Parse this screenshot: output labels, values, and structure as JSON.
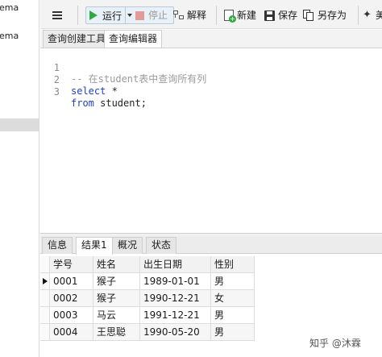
{
  "navigator": {
    "items": [
      "hema",
      "hema"
    ]
  },
  "toolbar": {
    "run_label": "运行",
    "stop_label": "停止",
    "explain_label": "解释",
    "new_label": "新建",
    "save_label": "保存",
    "saveas_label": "另存为",
    "beautify_label": "美"
  },
  "tabs": [
    {
      "label": "查询创建工具"
    },
    {
      "label": "查询编辑器"
    }
  ],
  "editor": {
    "lines": [
      {
        "num": "1",
        "parts": [
          {
            "type": "comment",
            "text": "-- 在student表中查询所有列"
          }
        ]
      },
      {
        "num": "2",
        "parts": [
          {
            "type": "kw",
            "text": "select"
          },
          {
            "type": "plain",
            "text": " *"
          }
        ]
      },
      {
        "num": "3",
        "parts": [
          {
            "type": "kw",
            "text": "from"
          },
          {
            "type": "plain",
            "text": " student;"
          }
        ]
      }
    ]
  },
  "result_tabs": [
    {
      "label": "信息"
    },
    {
      "label": "结果1"
    },
    {
      "label": "概况"
    },
    {
      "label": "状态"
    }
  ],
  "grid": {
    "columns": [
      "学号",
      "姓名",
      "出生日期",
      "性别"
    ],
    "rows": [
      [
        "0001",
        "猴子",
        "1989-01-01",
        "男"
      ],
      [
        "0002",
        "猴子",
        "1990-12-21",
        "女"
      ],
      [
        "0003",
        "马云",
        "1991-12-21",
        "男"
      ],
      [
        "0004",
        "王思聪",
        "1990-05-20",
        "男"
      ]
    ]
  },
  "watermark": "知乎 @沐霖",
  "colors": {
    "run_green": "#2faa3f",
    "keyword_blue": "#1d3fbf",
    "comment_gray": "#9a9a9a",
    "stop_disabled": "#e59a9a"
  }
}
